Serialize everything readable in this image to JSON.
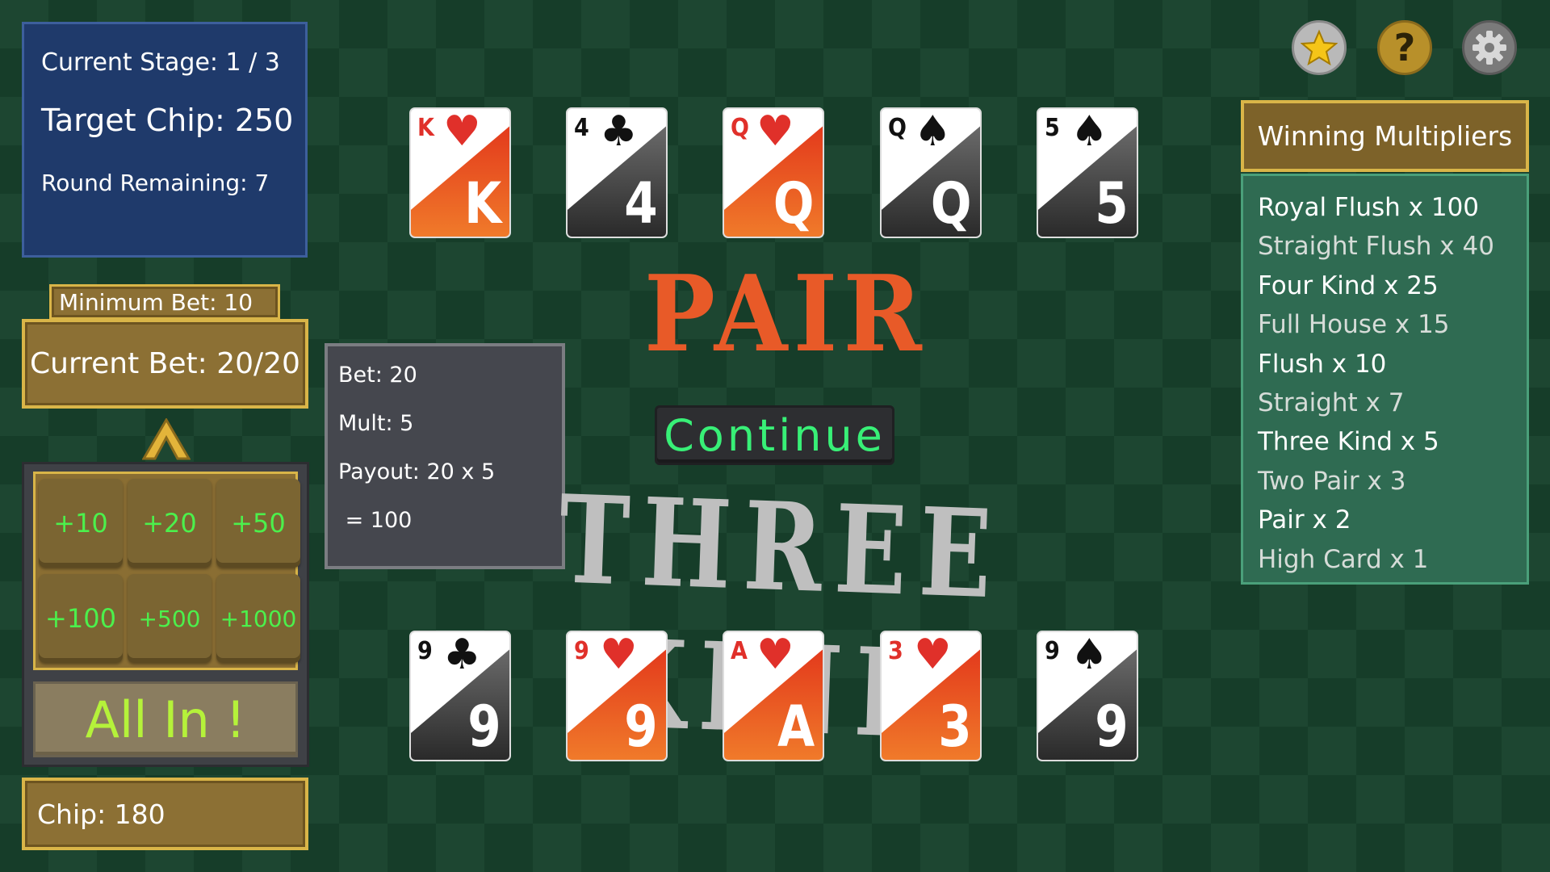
{
  "stage_panel": {
    "current_stage": "Current Stage: 1 / 3",
    "target_chip": "Target Chip: 250",
    "round_remaining": "Round Remaining: 7"
  },
  "bet": {
    "minimum": "Minimum Bet: 10",
    "current": "Current Bet: 20/20",
    "chip_buttons": [
      "+10",
      "+20",
      "+50",
      "+100",
      "+500",
      "+1000"
    ],
    "all_in": "All In !",
    "chip": "Chip: 180"
  },
  "payout": {
    "bet": "Bet: 20",
    "mult": "Mult: 5",
    "payout": "Payout: 20 x 5",
    "result": " = 100"
  },
  "dealer_hand": {
    "title": "PAIR",
    "cards": [
      {
        "rank": "K",
        "suit": "♥",
        "color": "red"
      },
      {
        "rank": "4",
        "suit": "♣",
        "color": "black"
      },
      {
        "rank": "Q",
        "suit": "♥",
        "color": "red"
      },
      {
        "rank": "Q",
        "suit": "♠",
        "color": "black"
      },
      {
        "rank": "5",
        "suit": "♠",
        "color": "black"
      }
    ]
  },
  "player_hand": {
    "title": "THREE KIND",
    "cards": [
      {
        "rank": "9",
        "suit": "♣",
        "color": "black"
      },
      {
        "rank": "9",
        "suit": "♥",
        "color": "red"
      },
      {
        "rank": "A",
        "suit": "♥",
        "color": "red"
      },
      {
        "rank": "3",
        "suit": "♥",
        "color": "red"
      },
      {
        "rank": "9",
        "suit": "♠",
        "color": "black"
      }
    ]
  },
  "continue_label": "Continue",
  "top_icons": [
    "star-icon",
    "help-icon",
    "gear-icon"
  ],
  "multipliers": {
    "title": "Winning Multipliers",
    "items": [
      "Royal Flush x 100",
      "Straight Flush x 40",
      "Four Kind x 25",
      "Full House x 15",
      "Flush x 10",
      "Straight x 7",
      "Three Kind x 5",
      "Two Pair x 3",
      "Pair x 2",
      "High Card x 1"
    ]
  },
  "colors": {
    "red_card": "#e0302a",
    "black_card": "#1a1a1a",
    "pair_title": "#e85a28",
    "three_kind_title": "#bfbfbf",
    "continue_text": "#38f077",
    "chip_button_text": "#4cf04c",
    "all_in_text": "#b5f23a"
  }
}
